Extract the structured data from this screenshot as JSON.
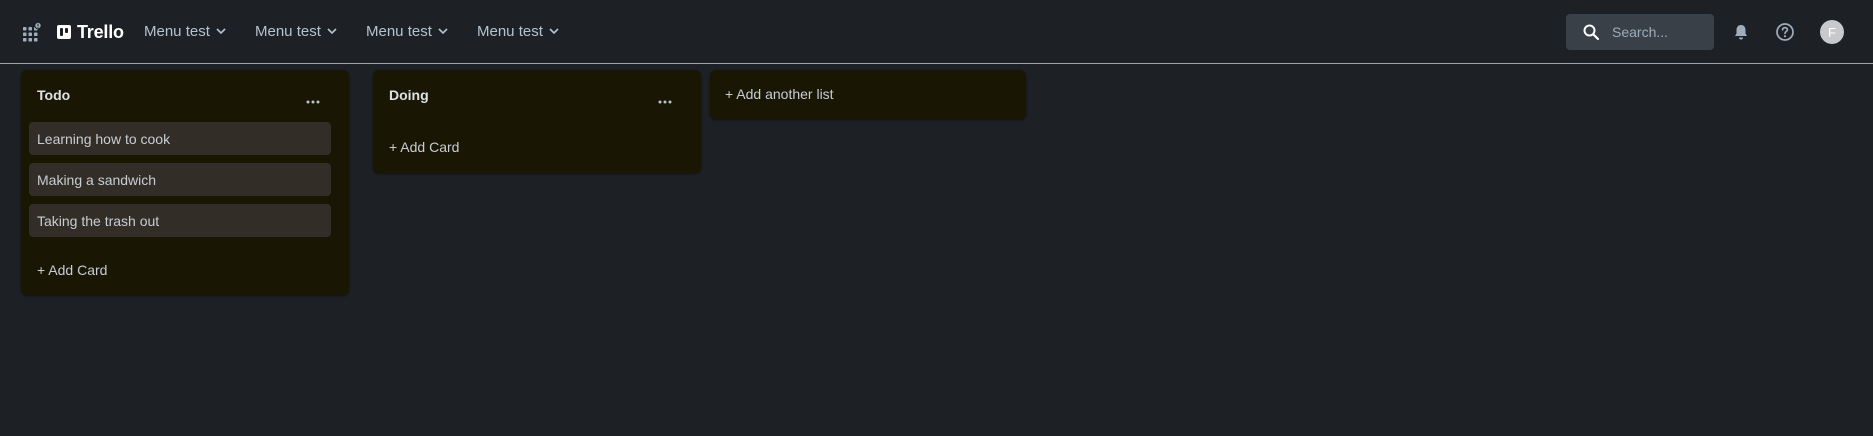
{
  "app": {
    "name": "Trello"
  },
  "nav": {
    "menus": [
      {
        "label": "Menu test"
      },
      {
        "label": "Menu test"
      },
      {
        "label": "Menu test"
      },
      {
        "label": "Menu test"
      }
    ]
  },
  "search": {
    "placeholder": "Search..."
  },
  "user": {
    "avatar_initial": "F"
  },
  "lists": [
    {
      "title": "Todo",
      "cards": [
        "Learning how to cook",
        "Making a sandwich",
        "Taking the trash out"
      ],
      "add_card_label": "+ Add Card"
    },
    {
      "title": "Doing",
      "cards": [],
      "add_card_label": "+ Add Card"
    }
  ],
  "add_list_label": "+ Add another list",
  "colors": {
    "background": "#1d2025",
    "list_bg": "#191604",
    "card_bg": "#332d27",
    "search_bg": "#3a4047"
  },
  "icons": {
    "apps": "apps-grid-icon",
    "search": "search-icon",
    "notifications": "bell-icon",
    "help": "help-icon",
    "chevron": "chevron-down-icon",
    "list_menu": "ellipsis-icon"
  }
}
